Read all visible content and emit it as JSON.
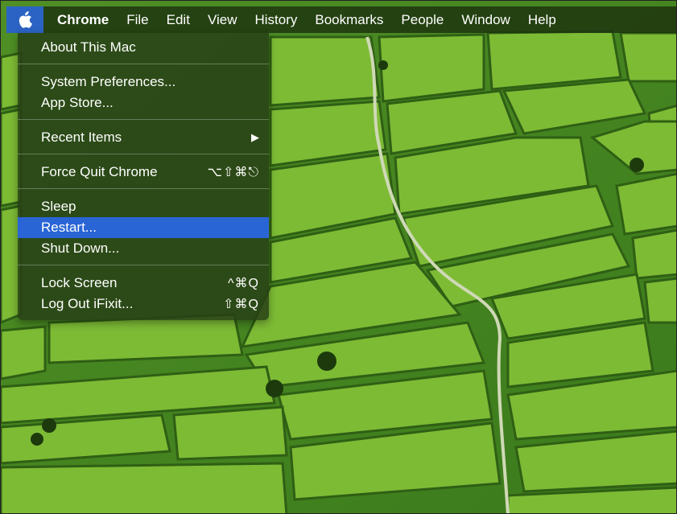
{
  "menubar": {
    "apple_icon": "apple-logo-icon",
    "items": [
      "Chrome",
      "File",
      "Edit",
      "View",
      "History",
      "Bookmarks",
      "People",
      "Window",
      "Help"
    ]
  },
  "apple_menu": {
    "about": "About This Mac",
    "system_prefs": "System Preferences...",
    "app_store": "App Store...",
    "recent_items": "Recent Items",
    "submenu_arrow": "▶",
    "force_quit": "Force Quit Chrome",
    "force_quit_shortcut": "⌥⇧⌘⎋",
    "sleep": "Sleep",
    "restart": "Restart...",
    "shut_down": "Shut Down...",
    "lock_screen": "Lock Screen",
    "lock_screen_shortcut": "^⌘Q",
    "log_out": "Log Out iFixit...",
    "log_out_shortcut": "⇧⌘Q",
    "selected_item": "Restart..."
  },
  "colors": {
    "selection": "#2a65d6",
    "field_light": "#8cc63f",
    "field_dark": "#3a7a1a"
  }
}
